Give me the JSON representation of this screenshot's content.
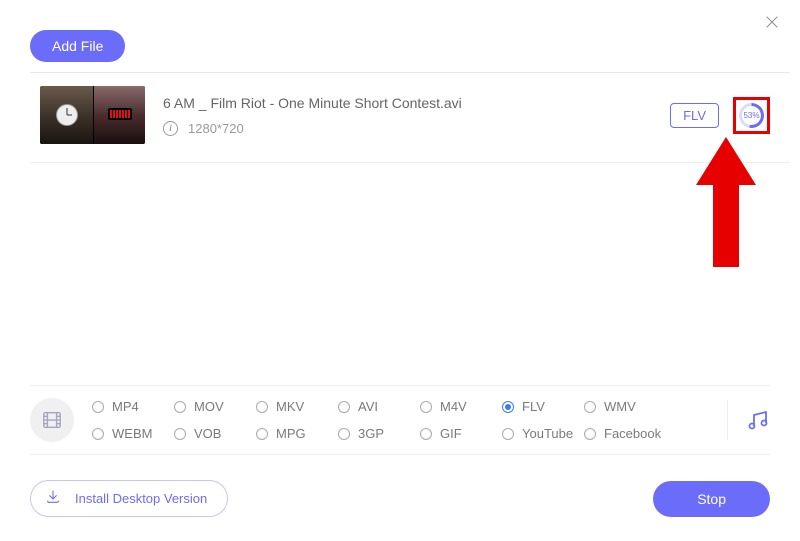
{
  "header": {
    "add_file_label": "Add File"
  },
  "file": {
    "title": "6 AM _ Film Riot - One Minute Short Contest.avi",
    "resolution": "1280*720",
    "format_badge": "FLV",
    "progress_text": "53%"
  },
  "formats": {
    "row1": [
      {
        "label": "MP4",
        "checked": false
      },
      {
        "label": "MOV",
        "checked": false
      },
      {
        "label": "MKV",
        "checked": false
      },
      {
        "label": "AVI",
        "checked": false
      },
      {
        "label": "M4V",
        "checked": false
      },
      {
        "label": "FLV",
        "checked": true
      },
      {
        "label": "WMV",
        "checked": false
      }
    ],
    "row2": [
      {
        "label": "WEBM",
        "checked": false
      },
      {
        "label": "VOB",
        "checked": false
      },
      {
        "label": "MPG",
        "checked": false
      },
      {
        "label": "3GP",
        "checked": false
      },
      {
        "label": "GIF",
        "checked": false
      },
      {
        "label": "YouTube",
        "checked": false
      },
      {
        "label": "Facebook",
        "checked": false
      }
    ]
  },
  "footer": {
    "install_label": "Install Desktop Version",
    "stop_label": "Stop"
  }
}
